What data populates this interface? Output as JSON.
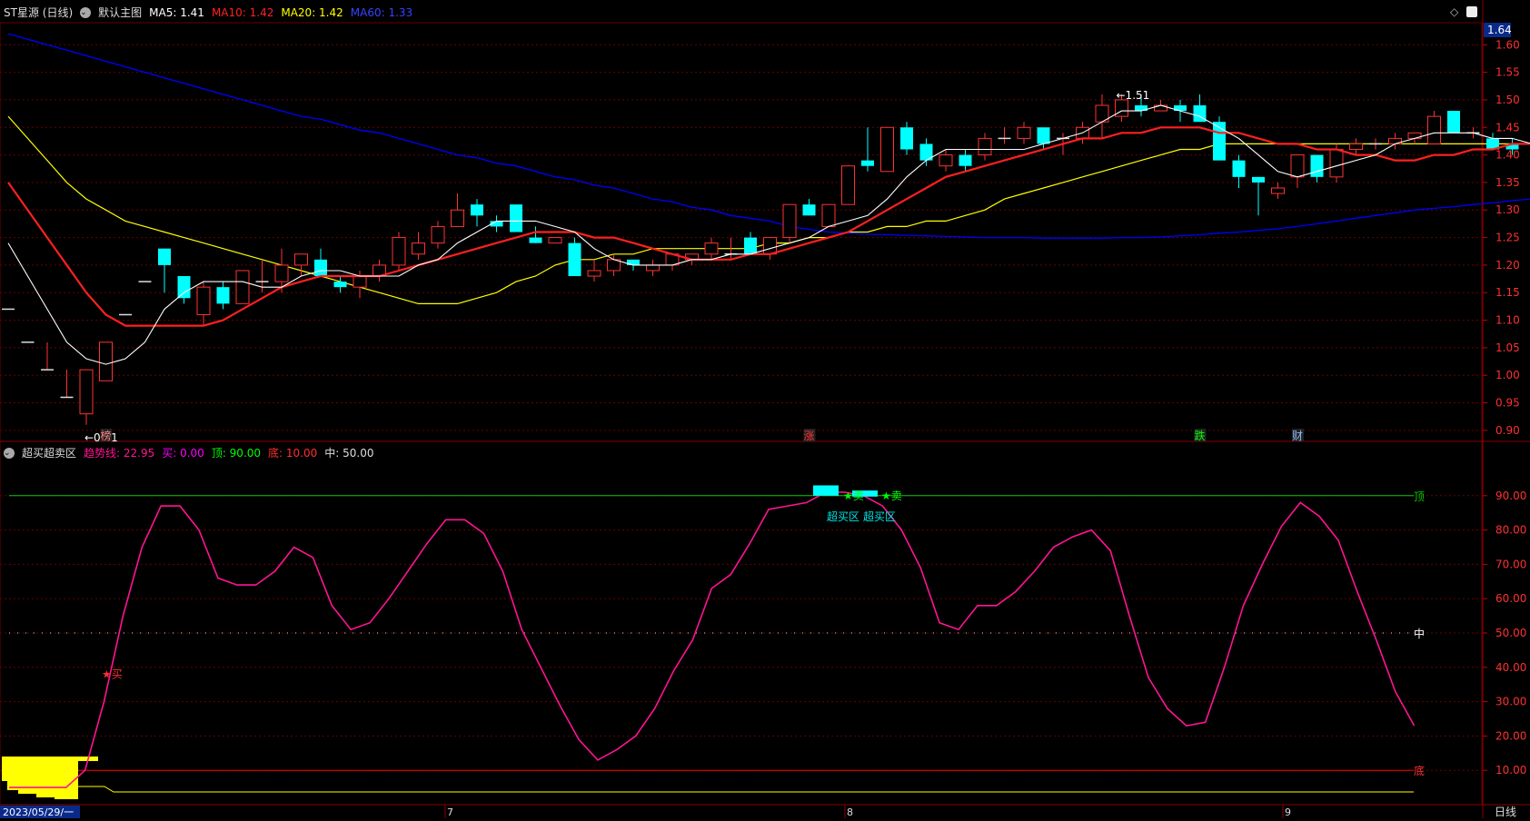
{
  "header": {
    "stock": "ST星源 (日线)",
    "template": "默认主图",
    "ma5_label": "MA5: 1.41",
    "ma10_label": "MA10: 1.42",
    "ma20_label": "MA20: 1.42",
    "ma60_label": "MA60: 1.33",
    "price_tag": "1.64"
  },
  "indicator_header": {
    "name": "超买超卖区",
    "trend": "趋势线: 22.95",
    "buy": "买: 0.00",
    "top": "顶: 90.00",
    "bottom": "底: 10.00",
    "mid": "中: 50.00"
  },
  "price_axis": {
    "ticks": [
      "1.60",
      "1.55",
      "1.50",
      "1.45",
      "1.40",
      "1.35",
      "1.30",
      "1.25",
      "1.20",
      "1.15",
      "1.10",
      "1.05",
      "1.00",
      "0.95",
      "0.90"
    ]
  },
  "osc_axis": {
    "ticks": [
      "90.00",
      "80.00",
      "70.00",
      "60.00",
      "50.00",
      "40.00",
      "30.00",
      "20.00",
      "10.00"
    ]
  },
  "x_axis": {
    "start_label": "2023/05/29/一",
    "months": [
      "7",
      "8",
      "9"
    ],
    "period": "日线"
  },
  "annotations": {
    "low": "←0.91",
    "high": "←1.51",
    "events": [
      "榜",
      "涨",
      "跌",
      "财"
    ],
    "buy_signal": "★买",
    "sell_signal": "★卖",
    "overbought_1": "超买区",
    "overbought_2": "超买区",
    "line_top": "顶",
    "line_mid": "中",
    "line_bottom": "底"
  },
  "colors": {
    "bg": "#000000",
    "up": "#ff3232",
    "down": "#00ffff",
    "ma5": "#ffffff",
    "ma10": "#ff2020",
    "ma20": "#ffff00",
    "ma60": "#0000ff",
    "osc": "#ff1493",
    "top": "#00cc00",
    "bottom": "#ff0000",
    "grid": "#6a0000"
  },
  "chart_data": [
    {
      "type": "candlestick",
      "title": "ST星源 (日线)",
      "ylim": [
        0.88,
        1.64
      ],
      "candles": [
        {
          "o": 1.12,
          "h": 1.12,
          "l": 1.12,
          "c": 1.12
        },
        {
          "o": 1.06,
          "h": 1.06,
          "l": 1.06,
          "c": 1.06
        },
        {
          "o": 1.01,
          "h": 1.06,
          "l": 1.01,
          "c": 1.01
        },
        {
          "o": 0.96,
          "h": 1.01,
          "l": 0.96,
          "c": 0.96
        },
        {
          "o": 0.93,
          "h": 1.01,
          "l": 0.91,
          "c": 1.01
        },
        {
          "o": 0.99,
          "h": 1.06,
          "l": 0.99,
          "c": 1.06
        },
        {
          "o": 1.11,
          "h": 1.11,
          "l": 1.11,
          "c": 1.11
        },
        {
          "o": 1.17,
          "h": 1.17,
          "l": 1.17,
          "c": 1.17
        },
        {
          "o": 1.23,
          "h": 1.23,
          "l": 1.15,
          "c": 1.2
        },
        {
          "o": 1.18,
          "h": 1.18,
          "l": 1.13,
          "c": 1.14
        },
        {
          "o": 1.11,
          "h": 1.17,
          "l": 1.09,
          "c": 1.16
        },
        {
          "o": 1.16,
          "h": 1.17,
          "l": 1.12,
          "c": 1.13
        },
        {
          "o": 1.13,
          "h": 1.19,
          "l": 1.13,
          "c": 1.19
        },
        {
          "o": 1.17,
          "h": 1.21,
          "l": 1.15,
          "c": 1.17
        },
        {
          "o": 1.17,
          "h": 1.23,
          "l": 1.15,
          "c": 1.2
        },
        {
          "o": 1.2,
          "h": 1.22,
          "l": 1.18,
          "c": 1.22
        },
        {
          "o": 1.21,
          "h": 1.23,
          "l": 1.18,
          "c": 1.18
        },
        {
          "o": 1.17,
          "h": 1.18,
          "l": 1.15,
          "c": 1.16
        },
        {
          "o": 1.16,
          "h": 1.19,
          "l": 1.14,
          "c": 1.18
        },
        {
          "o": 1.18,
          "h": 1.21,
          "l": 1.17,
          "c": 1.2
        },
        {
          "o": 1.2,
          "h": 1.26,
          "l": 1.19,
          "c": 1.25
        },
        {
          "o": 1.22,
          "h": 1.26,
          "l": 1.21,
          "c": 1.24
        },
        {
          "o": 1.24,
          "h": 1.28,
          "l": 1.23,
          "c": 1.27
        },
        {
          "o": 1.27,
          "h": 1.33,
          "l": 1.27,
          "c": 1.3
        },
        {
          "o": 1.31,
          "h": 1.32,
          "l": 1.27,
          "c": 1.29
        },
        {
          "o": 1.28,
          "h": 1.29,
          "l": 1.26,
          "c": 1.27
        },
        {
          "o": 1.31,
          "h": 1.31,
          "l": 1.26,
          "c": 1.26
        },
        {
          "o": 1.25,
          "h": 1.27,
          "l": 1.24,
          "c": 1.24
        },
        {
          "o": 1.24,
          "h": 1.25,
          "l": 1.24,
          "c": 1.25
        },
        {
          "o": 1.24,
          "h": 1.25,
          "l": 1.18,
          "c": 1.18
        },
        {
          "o": 1.18,
          "h": 1.21,
          "l": 1.17,
          "c": 1.19
        },
        {
          "o": 1.19,
          "h": 1.22,
          "l": 1.18,
          "c": 1.21
        },
        {
          "o": 1.21,
          "h": 1.21,
          "l": 1.19,
          "c": 1.2
        },
        {
          "o": 1.19,
          "h": 1.21,
          "l": 1.18,
          "c": 1.2
        },
        {
          "o": 1.2,
          "h": 1.22,
          "l": 1.19,
          "c": 1.22
        },
        {
          "o": 1.21,
          "h": 1.22,
          "l": 1.2,
          "c": 1.22
        },
        {
          "o": 1.22,
          "h": 1.25,
          "l": 1.21,
          "c": 1.24
        },
        {
          "o": 1.22,
          "h": 1.25,
          "l": 1.21,
          "c": 1.22
        },
        {
          "o": 1.25,
          "h": 1.26,
          "l": 1.22,
          "c": 1.22
        },
        {
          "o": 1.22,
          "h": 1.25,
          "l": 1.21,
          "c": 1.25
        },
        {
          "o": 1.25,
          "h": 1.31,
          "l": 1.24,
          "c": 1.31
        },
        {
          "o": 1.31,
          "h": 1.32,
          "l": 1.29,
          "c": 1.29
        },
        {
          "o": 1.27,
          "h": 1.31,
          "l": 1.27,
          "c": 1.31
        },
        {
          "o": 1.31,
          "h": 1.38,
          "l": 1.31,
          "c": 1.38
        },
        {
          "o": 1.39,
          "h": 1.45,
          "l": 1.37,
          "c": 1.38
        },
        {
          "o": 1.37,
          "h": 1.45,
          "l": 1.37,
          "c": 1.45
        },
        {
          "o": 1.45,
          "h": 1.46,
          "l": 1.4,
          "c": 1.41
        },
        {
          "o": 1.42,
          "h": 1.43,
          "l": 1.38,
          "c": 1.39
        },
        {
          "o": 1.38,
          "h": 1.41,
          "l": 1.37,
          "c": 1.4
        },
        {
          "o": 1.4,
          "h": 1.41,
          "l": 1.37,
          "c": 1.38
        },
        {
          "o": 1.4,
          "h": 1.44,
          "l": 1.39,
          "c": 1.43
        },
        {
          "o": 1.43,
          "h": 1.45,
          "l": 1.42,
          "c": 1.43
        },
        {
          "o": 1.43,
          "h": 1.46,
          "l": 1.42,
          "c": 1.45
        },
        {
          "o": 1.45,
          "h": 1.45,
          "l": 1.41,
          "c": 1.42
        },
        {
          "o": 1.43,
          "h": 1.44,
          "l": 1.4,
          "c": 1.43
        },
        {
          "o": 1.43,
          "h": 1.46,
          "l": 1.42,
          "c": 1.45
        },
        {
          "o": 1.46,
          "h": 1.51,
          "l": 1.43,
          "c": 1.49
        },
        {
          "o": 1.47,
          "h": 1.51,
          "l": 1.46,
          "c": 1.5
        },
        {
          "o": 1.49,
          "h": 1.51,
          "l": 1.47,
          "c": 1.48
        },
        {
          "o": 1.48,
          "h": 1.5,
          "l": 1.48,
          "c": 1.49
        },
        {
          "o": 1.49,
          "h": 1.5,
          "l": 1.46,
          "c": 1.48
        },
        {
          "o": 1.49,
          "h": 1.51,
          "l": 1.46,
          "c": 1.46
        },
        {
          "o": 1.46,
          "h": 1.47,
          "l": 1.39,
          "c": 1.39
        },
        {
          "o": 1.39,
          "h": 1.4,
          "l": 1.34,
          "c": 1.36
        },
        {
          "o": 1.36,
          "h": 1.36,
          "l": 1.29,
          "c": 1.35
        },
        {
          "o": 1.33,
          "h": 1.35,
          "l": 1.32,
          "c": 1.34
        },
        {
          "o": 1.36,
          "h": 1.4,
          "l": 1.34,
          "c": 1.4
        },
        {
          "o": 1.4,
          "h": 1.4,
          "l": 1.35,
          "c": 1.36
        },
        {
          "o": 1.36,
          "h": 1.42,
          "l": 1.35,
          "c": 1.41
        },
        {
          "o": 1.41,
          "h": 1.43,
          "l": 1.4,
          "c": 1.42
        },
        {
          "o": 1.42,
          "h": 1.43,
          "l": 1.41,
          "c": 1.42
        },
        {
          "o": 1.42,
          "h": 1.44,
          "l": 1.41,
          "c": 1.43
        },
        {
          "o": 1.43,
          "h": 1.44,
          "l": 1.42,
          "c": 1.44
        },
        {
          "o": 1.42,
          "h": 1.48,
          "l": 1.42,
          "c": 1.47
        },
        {
          "o": 1.48,
          "h": 1.48,
          "l": 1.44,
          "c": 1.44
        },
        {
          "o": 1.44,
          "h": 1.45,
          "l": 1.43,
          "c": 1.44
        },
        {
          "o": 1.43,
          "h": 1.44,
          "l": 1.41,
          "c": 1.41
        },
        {
          "o": 1.42,
          "h": 1.43,
          "l": 1.4,
          "c": 1.41
        },
        {
          "o": 1.42,
          "h": 1.43,
          "l": 1.41,
          "c": 1.42
        },
        {
          "o": 1.42,
          "h": 1.42,
          "l": 1.4,
          "c": 1.4
        },
        {
          "o": 1.4,
          "h": 1.41,
          "l": 1.39,
          "c": 1.4
        }
      ],
      "ma5": [
        1.24,
        1.18,
        1.12,
        1.06,
        1.03,
        1.02,
        1.03,
        1.06,
        1.12,
        1.15,
        1.17,
        1.17,
        1.17,
        1.16,
        1.16,
        1.18,
        1.19,
        1.19,
        1.18,
        1.18,
        1.18,
        1.2,
        1.21,
        1.24,
        1.26,
        1.28,
        1.28,
        1.28,
        1.27,
        1.26,
        1.23,
        1.21,
        1.2,
        1.2,
        1.2,
        1.21,
        1.21,
        1.22,
        1.22,
        1.23,
        1.24,
        1.25,
        1.27,
        1.28,
        1.29,
        1.32,
        1.36,
        1.39,
        1.41,
        1.41,
        1.41,
        1.41,
        1.41,
        1.42,
        1.43,
        1.44,
        1.46,
        1.48,
        1.48,
        1.49,
        1.48,
        1.47,
        1.45,
        1.43,
        1.4,
        1.37,
        1.36,
        1.37,
        1.38,
        1.39,
        1.4,
        1.42,
        1.43,
        1.44,
        1.44,
        1.44,
        1.43,
        1.43,
        1.42,
        1.42,
        1.41
      ],
      "ma10": [
        1.35,
        1.3,
        1.25,
        1.2,
        1.15,
        1.11,
        1.09,
        1.09,
        1.09,
        1.09,
        1.09,
        1.1,
        1.12,
        1.14,
        1.16,
        1.17,
        1.18,
        1.18,
        1.18,
        1.18,
        1.19,
        1.2,
        1.21,
        1.22,
        1.23,
        1.24,
        1.25,
        1.26,
        1.26,
        1.26,
        1.25,
        1.25,
        1.24,
        1.23,
        1.22,
        1.21,
        1.21,
        1.21,
        1.22,
        1.22,
        1.23,
        1.24,
        1.25,
        1.26,
        1.28,
        1.3,
        1.32,
        1.34,
        1.36,
        1.37,
        1.38,
        1.39,
        1.4,
        1.41,
        1.42,
        1.43,
        1.43,
        1.44,
        1.44,
        1.45,
        1.45,
        1.45,
        1.44,
        1.44,
        1.43,
        1.42,
        1.42,
        1.41,
        1.41,
        1.4,
        1.4,
        1.39,
        1.39,
        1.4,
        1.4,
        1.41,
        1.41,
        1.42,
        1.42,
        1.42,
        1.42
      ],
      "ma20": [
        1.47,
        1.43,
        1.39,
        1.35,
        1.32,
        1.3,
        1.28,
        1.27,
        1.26,
        1.25,
        1.24,
        1.23,
        1.22,
        1.21,
        1.2,
        1.19,
        1.18,
        1.17,
        1.16,
        1.15,
        1.14,
        1.13,
        1.13,
        1.13,
        1.14,
        1.15,
        1.17,
        1.18,
        1.2,
        1.21,
        1.21,
        1.22,
        1.22,
        1.23,
        1.23,
        1.23,
        1.23,
        1.23,
        1.23,
        1.24,
        1.24,
        1.25,
        1.25,
        1.26,
        1.26,
        1.27,
        1.27,
        1.28,
        1.28,
        1.29,
        1.3,
        1.32,
        1.33,
        1.34,
        1.35,
        1.36,
        1.37,
        1.38,
        1.39,
        1.4,
        1.41,
        1.41,
        1.42,
        1.42,
        1.42,
        1.42,
        1.42,
        1.42,
        1.42,
        1.42,
        1.42,
        1.42,
        1.42,
        1.42,
        1.42,
        1.42,
        1.42,
        1.42,
        1.42,
        1.42,
        1.42
      ],
      "ma60": [
        1.62,
        1.61,
        1.6,
        1.59,
        1.58,
        1.57,
        1.56,
        1.55,
        1.54,
        1.53,
        1.52,
        1.51,
        1.5,
        1.49,
        1.48,
        1.47,
        1.465,
        1.455,
        1.445,
        1.44,
        1.43,
        1.42,
        1.41,
        1.4,
        1.395,
        1.385,
        1.38,
        1.37,
        1.36,
        1.355,
        1.345,
        1.34,
        1.33,
        1.32,
        1.315,
        1.305,
        1.3,
        1.29,
        1.285,
        1.28,
        1.27,
        1.265,
        1.26,
        1.258,
        1.256,
        1.255,
        1.254,
        1.253,
        1.252,
        1.251,
        1.25,
        1.25,
        1.25,
        1.249,
        1.249,
        1.249,
        1.249,
        1.25,
        1.25,
        1.251,
        1.253,
        1.255,
        1.258,
        1.26,
        1.263,
        1.266,
        1.27,
        1.275,
        1.28,
        1.285,
        1.29,
        1.295,
        1.3,
        1.303,
        1.306,
        1.31,
        1.313,
        1.317,
        1.32,
        1.324,
        1.33
      ]
    },
    {
      "type": "line",
      "title": "超买超卖区",
      "ylim": [
        0,
        100
      ],
      "trend": [
        5,
        5,
        5,
        5,
        10,
        30,
        55,
        75,
        87,
        87,
        80,
        66,
        64,
        64,
        68,
        75,
        72,
        58,
        51,
        53,
        60,
        68,
        76,
        83,
        83,
        79,
        68,
        51,
        40,
        29,
        19,
        13,
        16,
        20,
        28,
        39,
        48,
        63,
        67,
        76,
        86,
        87,
        88,
        91,
        91,
        90,
        87,
        80,
        69,
        53,
        51,
        58,
        58,
        62,
        68,
        75,
        78,
        80,
        74,
        55,
        37,
        28,
        23,
        24,
        40,
        58,
        70,
        81,
        88,
        84,
        77,
        62,
        48,
        33,
        23
      ],
      "top": 90,
      "mid": 50,
      "bottom": 10,
      "volume_base": [
        9,
        9,
        9,
        9,
        9,
        9
      ]
    }
  ]
}
